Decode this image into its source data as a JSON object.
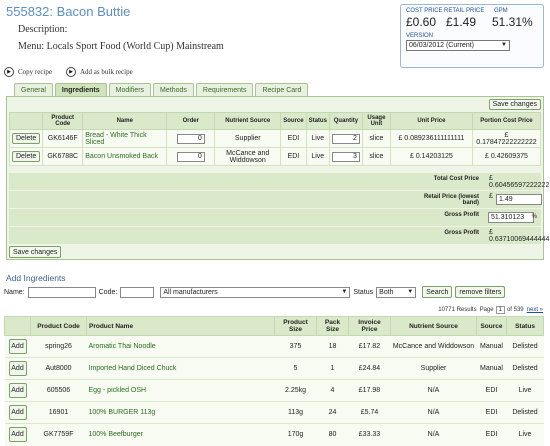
{
  "header": {
    "title": "555832: Bacon Buttie",
    "description_label": "Description:",
    "menu_label": "Menu: Locals Sport Food (World Cup) Mainstream"
  },
  "price_box": {
    "cost_label": "COST PRICE",
    "retail_label": "RETAIL PRICE",
    "gpm_label": "GPM",
    "cost_value": "£0.60",
    "retail_value": "£1.49",
    "gpm_value": "51.31%",
    "version_label": "VERSION",
    "version_value": "06/03/2012 (Current)"
  },
  "actions": {
    "copy": "Copy recipe",
    "bulk": "Add as bulk recipe"
  },
  "tabs": [
    "General",
    "Ingredients",
    "Modifiers",
    "Methods",
    "Requirements",
    "Recipe Card"
  ],
  "ingredients": {
    "save_label": "Save changes",
    "columns": [
      "",
      "Product Code",
      "Name",
      "Order",
      "Nutrient Source",
      "Source",
      "Status",
      "Quantity",
      "Usage Unit",
      "Unit Price",
      "Portion Cost Price"
    ],
    "rows": [
      {
        "delete": "Delete",
        "code": "GK6146F",
        "name": "Bread - White Thick Sliced",
        "order": "0",
        "nutrient": "Supplier",
        "source": "EDI",
        "status": "Live",
        "qty": "2",
        "unit": "slice",
        "unit_price": "£ 0.089236111111111",
        "portion": "£ 0.17847222222222"
      },
      {
        "delete": "Delete",
        "code": "GK6788C",
        "name": "Bacon Unsmoked Back",
        "order": "0",
        "nutrient": "McCance and Widdowson",
        "source": "EDI",
        "status": "Live",
        "qty": "3",
        "unit": "slice",
        "unit_price": "£ 0.14203125",
        "portion": "£ 0.42609375"
      }
    ],
    "total_label": "Total Cost Price",
    "total_value": "£ 0.60456597222222",
    "retail_label": "Retail Price (lowest band)",
    "retail_value": "1.49",
    "retail_currency": "£",
    "gp_pct_label": "Gross Profit",
    "gp_pct_value": "51.310123",
    "gp_pct_unit": "%",
    "gp_label": "Gross Profit",
    "gp_value": "£ 0.63710069444444"
  },
  "add_ingredients": {
    "title": "Add Ingredients",
    "name_label": "Name:",
    "code_label": "Code:",
    "manufacturer_value": "All manufacturers",
    "status_label": "Status",
    "status_value": "Both",
    "search_label": "Search",
    "remove_label": "remove filters",
    "results_text": "10771 Results",
    "page_label": "Page",
    "page_value": "1",
    "of_text": "of 539",
    "next_label": "next »",
    "columns": [
      "",
      "Product Code",
      "Product Name",
      "Product Size",
      "Pack Size",
      "Invoice Price",
      "Nutrient Source",
      "Source",
      "Status"
    ],
    "rows": [
      {
        "add": "Add",
        "code": "spring26",
        "name": "Aromatic Thai Noodle",
        "size": "375",
        "pack": "18",
        "price": "£17.82",
        "nutrient": "McCance and Widdowson",
        "source": "Manual",
        "status": "Delisted"
      },
      {
        "add": "Add",
        "code": "Aut8000",
        "name": "Imported Hand Diced Chuck",
        "size": "5",
        "pack": "1",
        "price": "£24.84",
        "nutrient": "Supplier",
        "source": "Manual",
        "status": "Delisted"
      },
      {
        "add": "Add",
        "code": "605506",
        "name": "Egg - pickled OSH",
        "size": "2.25kg",
        "pack": "4",
        "price": "£17.98",
        "nutrient": "N/A",
        "source": "EDI",
        "status": "Live"
      },
      {
        "add": "Add",
        "code": "16901",
        "name": "100% BURGER 113g",
        "size": "113g",
        "pack": "24",
        "price": "£5.74",
        "nutrient": "N/A",
        "source": "EDI",
        "status": "Delisted"
      },
      {
        "add": "Add",
        "code": "GK7759F",
        "name": "100% Beefburger",
        "size": "170g",
        "pack": "80",
        "price": "£33.33",
        "nutrient": "N/A",
        "source": "EDI",
        "status": "Live"
      }
    ]
  }
}
